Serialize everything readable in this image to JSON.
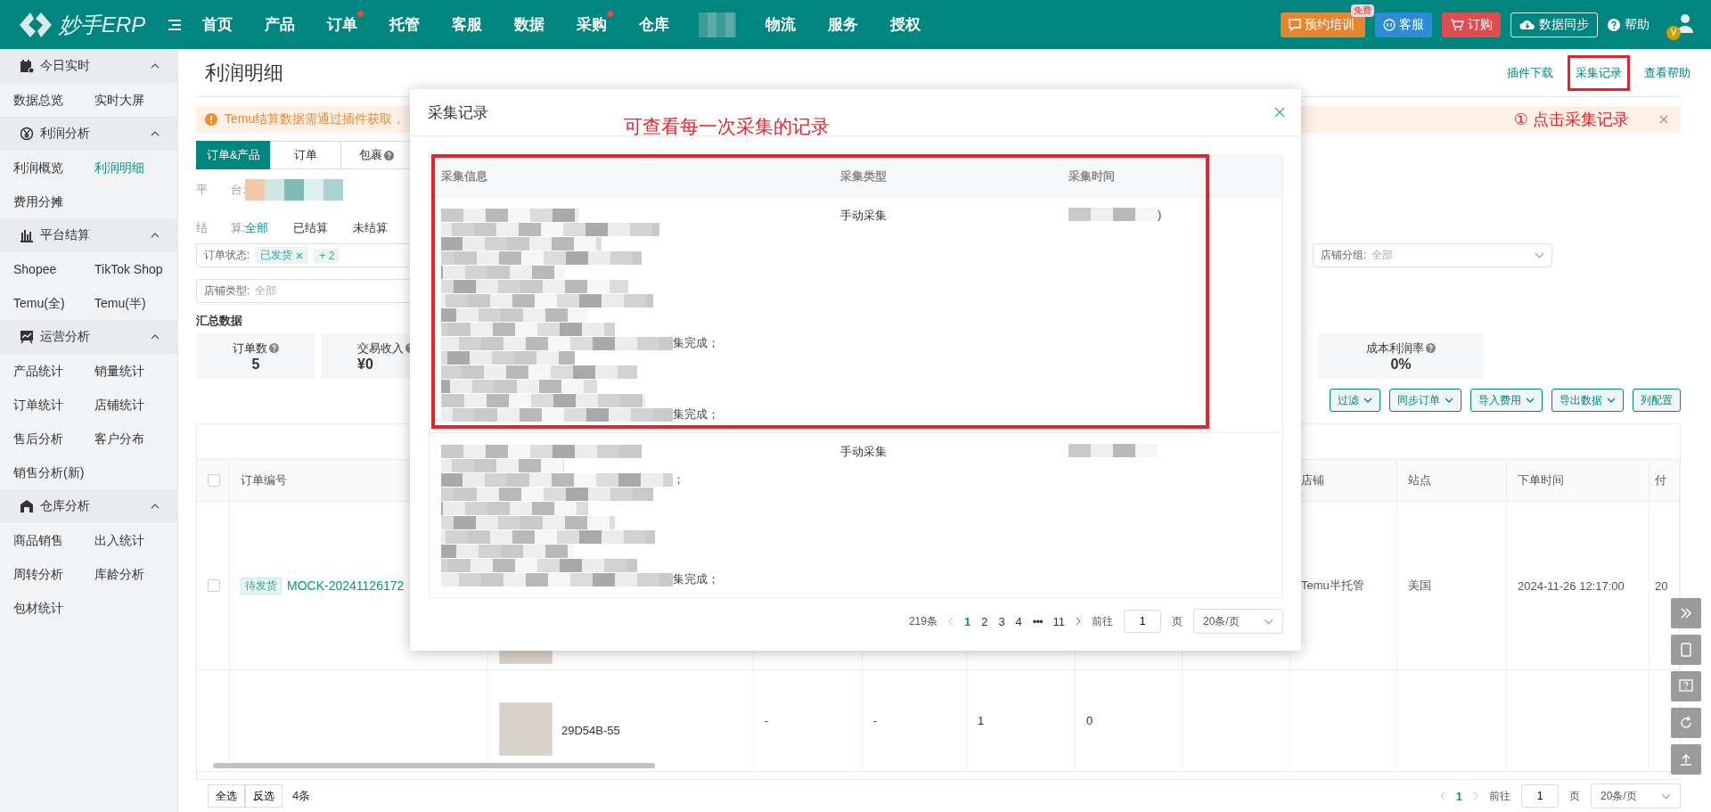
{
  "topbar": {
    "logo": "妙手ERP",
    "nav": [
      {
        "kind": "link",
        "label": "首页",
        "dot": false
      },
      {
        "kind": "link",
        "label": "产品",
        "dot": false
      },
      {
        "kind": "link",
        "label": "订单",
        "dot": true
      },
      {
        "kind": "link",
        "label": "托管",
        "dot": false
      },
      {
        "kind": "link",
        "label": "客服",
        "dot": false
      },
      {
        "kind": "link",
        "label": "数据",
        "dot": false
      },
      {
        "kind": "link",
        "label": "采购",
        "dot": true
      },
      {
        "kind": "link",
        "label": "仓库",
        "dot": false
      },
      {
        "kind": "redacted"
      },
      {
        "kind": "link",
        "label": "物流",
        "dot": false
      },
      {
        "kind": "link",
        "label": "服务",
        "dot": false
      },
      {
        "kind": "link",
        "label": "授权",
        "dot": false
      }
    ],
    "actions": [
      {
        "kind": "training",
        "label": "预约培训",
        "badge": "免费"
      },
      {
        "kind": "service",
        "label": "客服"
      },
      {
        "kind": "order",
        "label": "订购"
      },
      {
        "kind": "sync",
        "label": "数据同步"
      },
      {
        "kind": "help",
        "label": "帮助"
      }
    ],
    "avatar_badge": "V"
  },
  "sidebar": {
    "groups": [
      {
        "title": "今日实时",
        "expanded": true,
        "items": [
          {
            "label": "数据总览",
            "selected": false
          },
          {
            "label": "实时大屏",
            "selected": false
          }
        ]
      },
      {
        "title": "利润分析",
        "expanded": true,
        "items": [
          {
            "label": "利润概览",
            "selected": false
          },
          {
            "label": "利润明细",
            "selected": true
          },
          {
            "label": "费用分摊",
            "selected": false
          }
        ]
      },
      {
        "title": "平台结算",
        "expanded": true,
        "items": [
          {
            "label": "Shopee",
            "selected": false
          },
          {
            "label": "TikTok Shop",
            "selected": false
          },
          {
            "label": "Temu(全)",
            "selected": false
          },
          {
            "label": "Temu(半)",
            "selected": false
          }
        ]
      },
      {
        "title": "运营分析",
        "expanded": true,
        "items": [
          {
            "label": "产品统计",
            "selected": false
          },
          {
            "label": "销量统计",
            "selected": false
          },
          {
            "label": "订单统计",
            "selected": false
          },
          {
            "label": "店铺统计",
            "selected": false
          },
          {
            "label": "售后分析",
            "selected": false
          },
          {
            "label": "客户分布",
            "selected": false
          },
          {
            "label": "销售分析(新)",
            "selected": false
          }
        ]
      },
      {
        "title": "仓库分析",
        "expanded": true,
        "items": [
          {
            "label": "商品销售",
            "selected": false
          },
          {
            "label": "出入统计",
            "selected": false
          },
          {
            "label": "周转分析",
            "selected": false
          },
          {
            "label": "库龄分析",
            "selected": false
          },
          {
            "label": "包材统计",
            "selected": false
          }
        ]
      }
    ]
  },
  "page": {
    "title": "利润明细",
    "links": [
      {
        "label": "插件下载",
        "annotated": false
      },
      {
        "label": "采集记录",
        "annotated": true
      },
      {
        "label": "查看帮助",
        "annotated": false
      }
    ],
    "alert": {
      "text": "Temu结算数据需通过插件获取，",
      "annotation": "① 点击采集记录"
    },
    "view_tabs": [
      {
        "label": "订单&产品",
        "selected": true,
        "help": false
      },
      {
        "label": "订单",
        "selected": false,
        "help": false
      },
      {
        "label": "包裹",
        "selected": false,
        "help": true
      }
    ],
    "platform_label": "平　　台:",
    "settle_label": "结　　算:",
    "settle_options": [
      {
        "label": "全部",
        "selected": true
      },
      {
        "label": "已结算",
        "selected": false
      },
      {
        "label": "未结算",
        "selected": false
      }
    ],
    "order_status": {
      "label": "订单状态:",
      "tags": [
        "已发货"
      ],
      "more": "+ 2"
    },
    "shop_group": {
      "label": "店铺分组:",
      "value": "全部"
    },
    "shop_type": {
      "label": "店铺类型:",
      "value": "全部"
    },
    "summary_title": "汇总数据",
    "cards": [
      {
        "label": "订单数",
        "value": "5"
      },
      {
        "label": "交易收入",
        "value": "¥0"
      }
    ],
    "right_cards": [
      {
        "label": "成本利润率",
        "value": "0%"
      }
    ],
    "toolbar": [
      {
        "label": "过滤",
        "caret": true
      },
      {
        "label": "同步订单",
        "caret": true
      },
      {
        "label": "导入费用",
        "caret": true
      },
      {
        "label": "导出数据",
        "caret": true
      },
      {
        "label": "列配置",
        "caret": false
      }
    ],
    "table": {
      "header_checked": false,
      "left_column": "订单编号",
      "right_columns": [
        "店铺",
        "站点",
        "下单时间",
        "付"
      ],
      "order_row": {
        "checked": false,
        "status": "待发货",
        "order_no": "MOCK-20241126172",
        "shop": "Temu半托管",
        "site": "美国",
        "order_time": "2024-11-26 12:17:00",
        "pay": "20"
      },
      "product_row": {
        "sku": "29D54B-55",
        "cells": [
          "-",
          "-",
          "1",
          "0"
        ]
      }
    },
    "footer": {
      "buttons": [
        "全选",
        "反选"
      ],
      "count": "4条",
      "pages": [
        {
          "label": "1",
          "selected": true
        }
      ],
      "goto": "前往",
      "page_input": "1",
      "page_unit": "页",
      "page_size": "20条/页"
    }
  },
  "modal": {
    "title": "采集记录",
    "annotation": "可查看每一次采集的记录",
    "columns": [
      "采集信息",
      "采集类型",
      "采集时间"
    ],
    "rows": [
      {
        "annotated": true,
        "type": "手动采集",
        "time_tail": ")",
        "lines": [
          {
            "redacted": true
          },
          {
            "redacted": true
          },
          {
            "redacted": true
          },
          {
            "redacted": true
          },
          {
            "redacted": true
          },
          {
            "redacted": true
          },
          {
            "redacted": true
          },
          {
            "redacted": true
          },
          {
            "redacted": true
          },
          {
            "redacted": true,
            "tail": "集完成；"
          },
          {
            "redacted": true
          },
          {
            "redacted": true
          },
          {
            "redacted": true
          },
          {
            "redacted": true
          },
          {
            "redacted": true,
            "tail": "集完成；"
          }
        ]
      },
      {
        "annotated": false,
        "type": "手动采集",
        "lines": [
          {
            "redacted": true
          },
          {
            "redacted": true
          },
          {
            "redacted": true,
            "tail": "；"
          },
          {
            "redacted": true
          },
          {
            "redacted": true
          },
          {
            "redacted": true
          },
          {
            "redacted": true
          },
          {
            "redacted": true
          },
          {
            "redacted": true
          },
          {
            "redacted": true,
            "tail": "集完成；"
          }
        ]
      }
    ],
    "total": "219条",
    "pages": [
      {
        "label": "1",
        "selected": true,
        "kind": "page"
      },
      {
        "label": "2",
        "selected": false,
        "kind": "page"
      },
      {
        "label": "3",
        "selected": false,
        "kind": "page"
      },
      {
        "label": "4",
        "selected": false,
        "kind": "page"
      },
      {
        "label": "•••",
        "kind": "ellipsis"
      },
      {
        "label": "11",
        "selected": false,
        "kind": "page"
      }
    ],
    "goto": "前往",
    "page_input": "1",
    "page_unit": "页",
    "page_size": "20条/页"
  }
}
